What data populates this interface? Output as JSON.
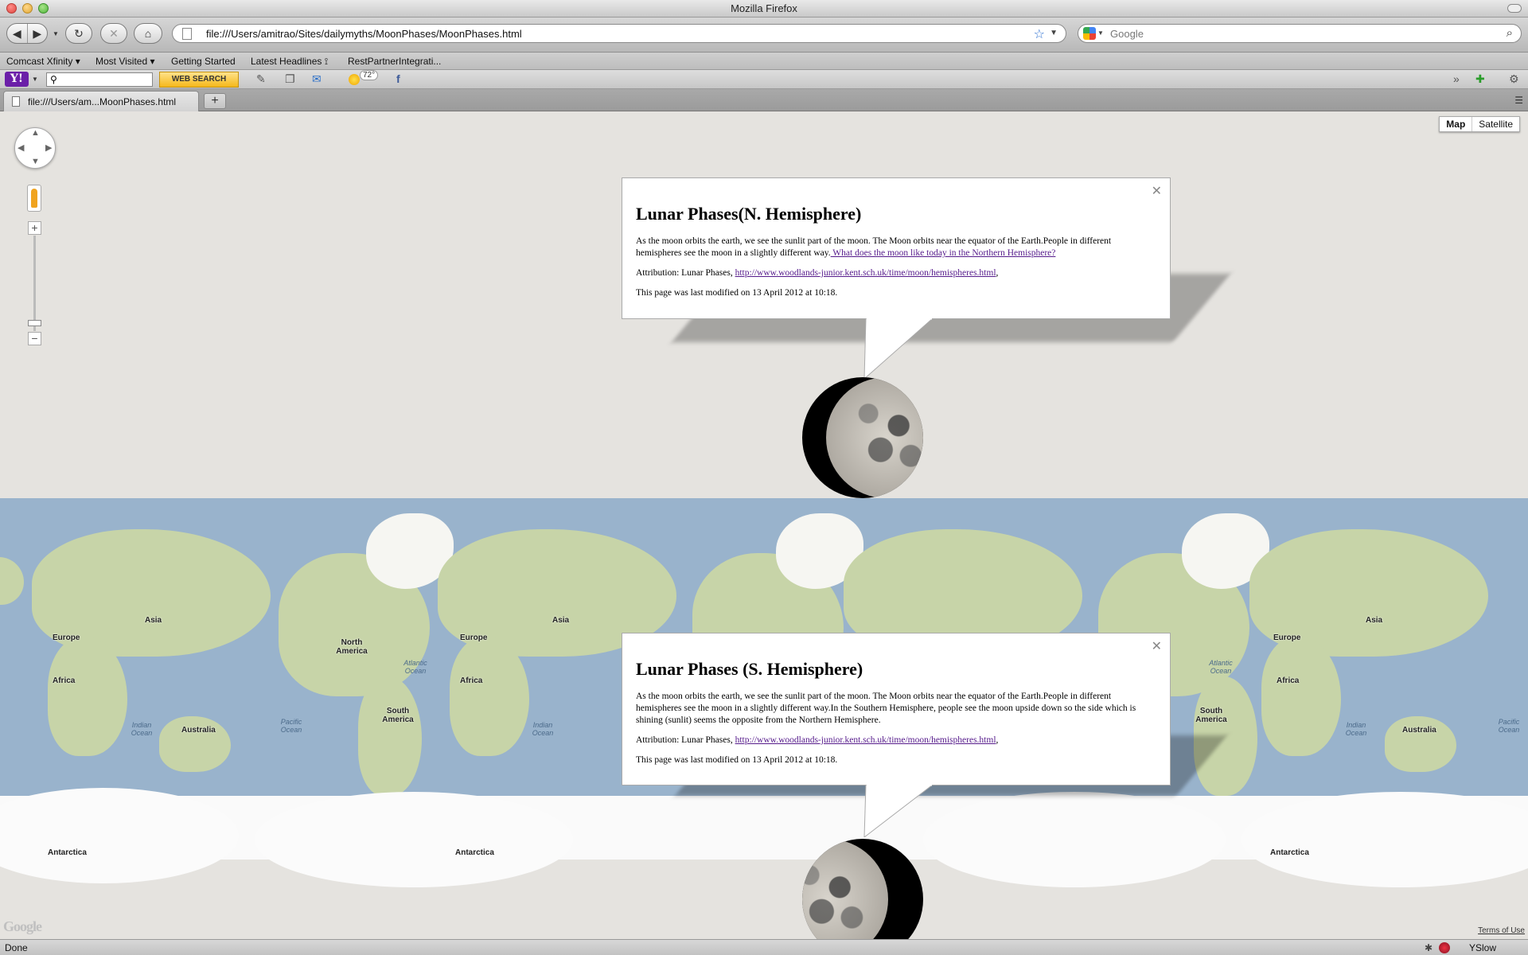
{
  "window": {
    "title": "Mozilla Firefox"
  },
  "nav": {
    "url": "file:///Users/amitrao/Sites/dailymyths/MoonPhases/MoonPhases.html",
    "search_placeholder": "Google"
  },
  "bookmarks": [
    {
      "label": "Comcast Xfinity ▾"
    },
    {
      "label": "Most Visited ▾"
    },
    {
      "label": "Getting Started"
    },
    {
      "label": "Latest Headlines ⟟"
    },
    {
      "label": "RestPartnerIntegrati..."
    }
  ],
  "yahoo_toolbar": {
    "web_search_label": "WEB SEARCH",
    "temperature": "72°"
  },
  "tabs": [
    {
      "label": "file:///Users/am...MoonPhases.html"
    }
  ],
  "map": {
    "type_control": {
      "map_label": "Map",
      "satellite_label": "Satellite"
    },
    "labels": {
      "europe": "Europe",
      "asia": "Asia",
      "africa": "Africa",
      "australia": "Australia",
      "north_america": "North America",
      "south_america": "South America",
      "antarctica": "Antarctica",
      "atlantic": "Atlantic Ocean",
      "pacific": "Pacific Ocean",
      "indian": "Indian Ocean"
    },
    "google_logo": "Google",
    "terms_link": "Terms of Use"
  },
  "infowindows": {
    "north": {
      "title": "Lunar Phases(N. Hemisphere)",
      "body": "As the moon orbits the earth, we see the sunlit part of the moon. The Moon orbits near the equator of the Earth.People in different hemispheres see the moon in a slightly different way.",
      "link": " What does the moon like today in the Northern Hemisphere?",
      "attribution_prefix": "Attribution: Lunar Phases, ",
      "attribution_link": "http://www.woodlands-junior.kent.sch.uk/time/moon/hemispheres.html",
      "attribution_suffix": ",",
      "modified": "This page was last modified on 13 April 2012 at 10:18."
    },
    "south": {
      "title": "Lunar Phases (S. Hemisphere)",
      "body": "As the moon orbits the earth, we see the sunlit part of the moon. The Moon orbits near the equator of the Earth.People in different hemispheres see the moon in a slightly different way.In the Southern Hemisphere, people see the moon upside down so the side which is shining (sunlit) seems the opposite from the Northern Hemisphere.",
      "attribution_prefix": "Attribution: Lunar Phases, ",
      "attribution_link": "http://www.woodlands-junior.kent.sch.uk/time/moon/hemispheres.html",
      "attribution_suffix": ",",
      "modified": "This page was last modified on 13 April 2012 at 10:18."
    }
  },
  "status": {
    "text": "Done",
    "yslow_label": "YSlow"
  },
  "colors": {
    "ocean": "#99b3cc",
    "land": "#c7d4a8",
    "ice": "#fafafa",
    "background": "#e5e3df"
  }
}
